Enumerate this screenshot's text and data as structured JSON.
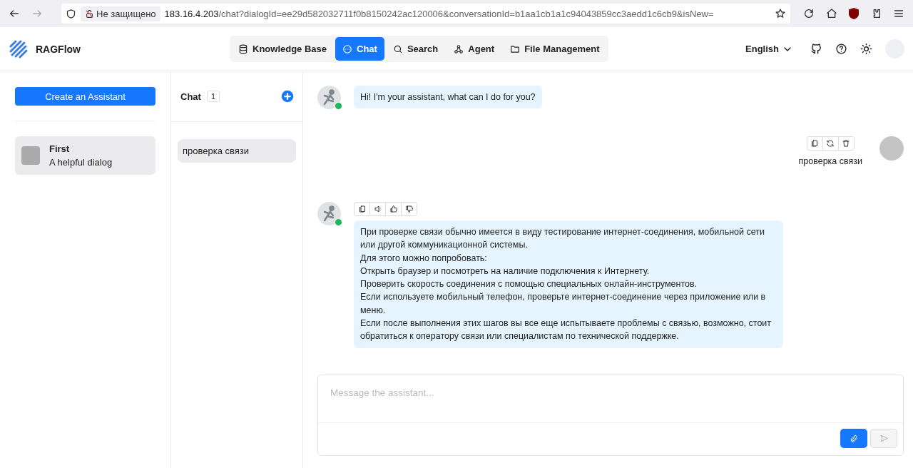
{
  "browser": {
    "security_label": "Не защищено",
    "url_host": "183.16.4.203",
    "url_path": "/chat?dialogId=ee29d582032711f0b8150242ac120006&conversationId=b1aa1cb1a1c94043859cc3aedd1c6cb9&isNew="
  },
  "header": {
    "logo_text": "RAGFlow",
    "nav": [
      {
        "label": "Knowledge Base",
        "selected": false
      },
      {
        "label": "Chat",
        "selected": true
      },
      {
        "label": "Search",
        "selected": false
      },
      {
        "label": "Agent",
        "selected": false
      },
      {
        "label": "File Management",
        "selected": false
      }
    ],
    "language": "English"
  },
  "assistants": {
    "create_button": "Create an Assistant",
    "items": [
      {
        "name": "First",
        "description": "A helpful dialog",
        "selected": true
      }
    ]
  },
  "chats": {
    "title": "Chat",
    "count": "1",
    "items": [
      {
        "title": "проверка связи",
        "selected": true
      }
    ]
  },
  "messages": [
    {
      "kind": "assistant",
      "online": true,
      "actions": false,
      "paragraphs": [
        "Hi! I'm your assistant, what can I do for you?"
      ]
    },
    {
      "kind": "user",
      "paragraphs": [
        "проверка связи"
      ]
    },
    {
      "kind": "assistant",
      "online": true,
      "actions": true,
      "paragraphs": [
        "При проверке связи обычно имеется в виду тестирование интернет-соединения, мобильной сети или другой коммуникационной системы.",
        "Для этого можно попробовать:",
        "Открыть браузер и посмотреть на наличие подключения к Интернету.",
        "Проверить скорость соединения с помощью специальных онлайн-инструментов.",
        "Если используете мобильный телефон, проверьте интернет-соединение через приложение или в меню.",
        "Если после выполнения этих шагов вы все еще испытываете проблемы с связью, возможно, стоит обратиться к оператору связи или специалистам по технической поддержке."
      ]
    }
  ],
  "composer": {
    "placeholder": "Message the assistant...",
    "send_disabled": true
  }
}
